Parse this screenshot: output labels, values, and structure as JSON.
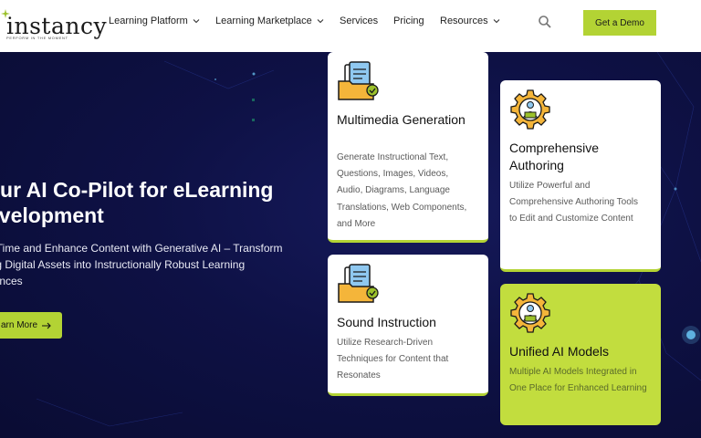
{
  "header": {
    "logo_text": "instancy",
    "logo_tagline": "PERFORM IN THE MOMENT",
    "nav": [
      {
        "label": "Learning Platform",
        "has_dropdown": true
      },
      {
        "label": "Learning Marketplace",
        "has_dropdown": true
      },
      {
        "label": "Services",
        "has_dropdown": false
      },
      {
        "label": "Pricing",
        "has_dropdown": false
      },
      {
        "label": "Resources",
        "has_dropdown": true
      }
    ],
    "search_icon": "search-icon",
    "cta_label": "Get a Demo"
  },
  "hero": {
    "title_line1": "our AI Co-Pilot for eLearning",
    "title_line2": "evelopment",
    "sub_line1": "e Time and Enhance Content with Generative AI – Transform",
    "sub_line2": "ing Digital Assets into Instructionally Robust Learning",
    "sub_line3": "riences",
    "button_label": "arn More"
  },
  "cards": [
    {
      "title": "Multimedia Generation",
      "text": "Generate Instructional Text, Questions, Images, Videos, Audio, Diagrams, Language Translations, Web Components, and More",
      "icon": "documents-icon"
    },
    {
      "title": "Comprehensive Authoring",
      "text": "Utilize Powerful and Comprehensive Authoring Tools to Edit and Customize Content",
      "icon": "gear-person-icon"
    },
    {
      "title": "Sound Instruction",
      "text": "Utilize Research-Driven Techniques for Content that Resonates",
      "icon": "documents-icon"
    },
    {
      "title": "Unified AI Models",
      "text": "Multiple AI Models Integrated in One Place for Enhanced Learning",
      "icon": "gear-person-icon"
    }
  ],
  "colors": {
    "accent": "#b3d334",
    "hero_bg": "#0e1145",
    "card_green": "#c2dd3e"
  }
}
